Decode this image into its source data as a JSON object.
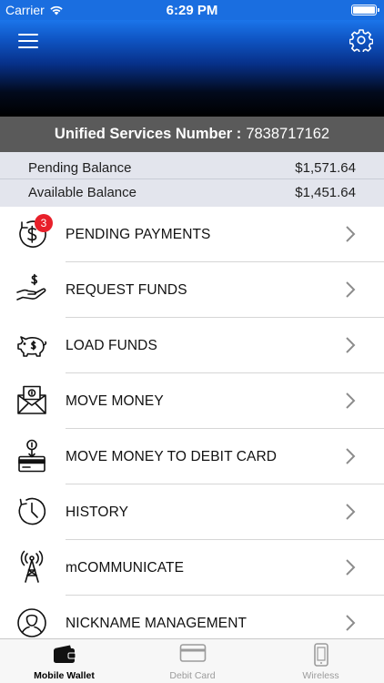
{
  "status_bar": {
    "carrier": "Carrier",
    "time": "6:29 PM"
  },
  "header": {
    "menu_icon": "hamburger-icon",
    "settings_icon": "gear-icon"
  },
  "usn": {
    "label": "Unified Services Number :",
    "value": "7838717162"
  },
  "balances": [
    {
      "label": "Pending Balance",
      "amount": "$1,571.64"
    },
    {
      "label": "Available Balance",
      "amount": "$1,451.64"
    }
  ],
  "menu": [
    {
      "label": "PENDING PAYMENTS",
      "icon": "dollar-clock-icon",
      "badge": "3"
    },
    {
      "label": "REQUEST FUNDS",
      "icon": "hand-dollar-icon"
    },
    {
      "label": "LOAD FUNDS",
      "icon": "piggy-bank-icon"
    },
    {
      "label": "MOVE MONEY",
      "icon": "envelope-money-icon"
    },
    {
      "label": "MOVE MONEY TO DEBIT CARD",
      "icon": "card-transfer-icon"
    },
    {
      "label": "HISTORY",
      "icon": "clock-history-icon"
    },
    {
      "label": "mCOMMUNICATE",
      "icon": "antenna-icon"
    },
    {
      "label": "NICKNAME MANAGEMENT",
      "icon": "user-profile-icon"
    }
  ],
  "tabs": [
    {
      "label": "Mobile Wallet",
      "icon": "wallet-icon",
      "active": true
    },
    {
      "label": "Debit Card",
      "icon": "card-icon",
      "active": false
    },
    {
      "label": "Wireless",
      "icon": "phone-icon",
      "active": false
    }
  ],
  "colors": {
    "header_top": "#1b75ea",
    "header_bottom": "#000000",
    "usn_bar": "#5a5a5a",
    "balance_bg": "#e3e5ed",
    "badge": "#e8202a"
  }
}
